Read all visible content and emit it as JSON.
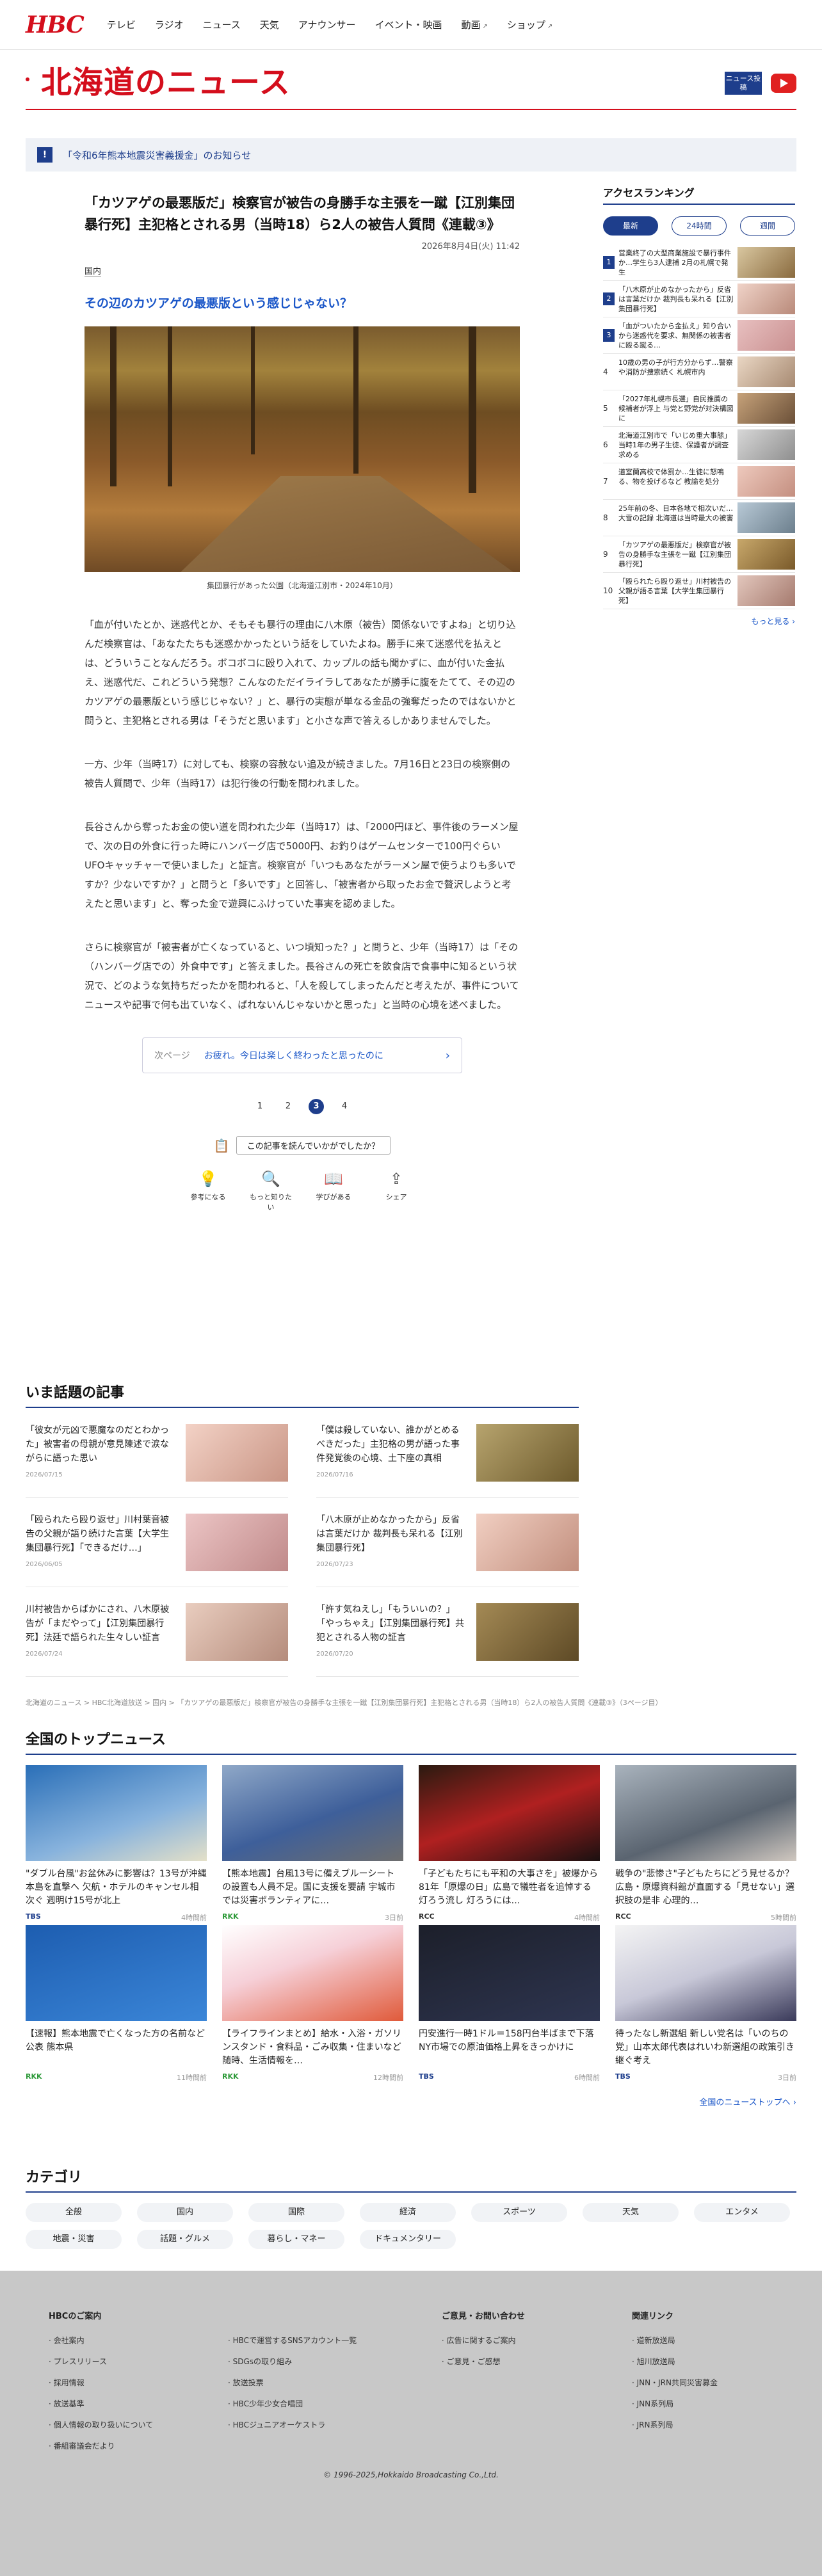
{
  "header": {
    "logo": "HBC",
    "nav": [
      {
        "label": "テレビ"
      },
      {
        "label": "ラジオ"
      },
      {
        "label": "ニュース"
      },
      {
        "label": "天気"
      },
      {
        "label": "アナウンサー"
      },
      {
        "label": "イベント・映画"
      },
      {
        "label": "動画",
        "ext": "↗"
      },
      {
        "label": "ショップ",
        "ext": "↗"
      }
    ],
    "section_title": "北海道のニュース",
    "news_badge": "ニュース投稿"
  },
  "notice": {
    "text": "「令和6年熊本地震災害義援金」のお知らせ"
  },
  "article": {
    "title": "「カツアゲの最悪版だ」検察官が被告の身勝手な主張を一蹴【江別集団暴行死】主犯格とされる男（当時18）ら2人の被告人質問《連載③》",
    "date": "2026年8月4日(火) 11:42",
    "category": "国内",
    "lead": "その辺のカツアゲの最悪版という感じじゃない？",
    "caption": "集団暴行があった公園（北海道江別市・2024年10月）",
    "paragraphs": [
      "「血が付いたとか、迷惑代とか、そもそも暴行の理由に八木原（被告）関係ないですよね」と切り込んだ検察官は、「あなたたちも迷惑かかったという話をしていたよね。勝手に来て迷惑代を払えとは、どういうことなんだろう。ボコボコに殴り入れて、カップルの話も聞かずに、血が付いた金払え、迷惑代だ、これどういう発想？こんなのただイライラしてあなたが勝手に腹をたてて、その辺のカツアゲの最悪版という感じじゃない？」と、暴行の実態が単なる金品の強奪だったのではないかと問うと、主犯格とされる男は「そうだと思います」と小さな声で答えるしかありませんでした。",
      "一方、少年（当時17）に対しても、検察の容赦ない追及が続きました。7月16日と23日の検察側の被告人質問で、少年（当時17）は犯行後の行動を問われました。",
      "長谷さんから奪ったお金の使い道を問われた少年（当時17）は、「2000円ほど、事件後のラーメン屋で、次の日の外食に行った時にハンバーグ店で5000円、お釣りはゲームセンターで100円ぐらいUFOキャッチャーで使いました」と証言。検察官が「いつもあなたがラーメン屋で使うよりも多いですか？少ないですか？」と問うと「多いです」と回答し、「被害者から取ったお金で贅沢しようと考えたと思います」と、奪った金で遊興にふけっていた事実を認めました。",
      "さらに検察官が「被害者が亡くなっていると、いつ頃知った？」と問うと、少年（当時17）は「その（ハンバーグ店での）外食中です」と答えました。長谷さんの死亡を飲食店で食事中に知るという状況で、どのような気持ちだったかを問われると、「人を殺してしまったんだと考えたが、事件についてニュースや記事で何も出ていなく、ばれないんじゃないかと思った」と当時の心境を述べました。"
    ],
    "next": {
      "label": "次ページ",
      "title": "お疲れ。今日は楽しく終わったと思ったのに"
    },
    "pages": [
      "1",
      "2",
      "3",
      "4"
    ],
    "current_page": "3",
    "feedback_q": "この記事を読んでいかがでしたか？",
    "reactions": [
      {
        "icon": "bulb-icon",
        "glyph": "💡",
        "label": "参考になる"
      },
      {
        "icon": "search-icon",
        "glyph": "🔍",
        "label": "もっと知りたい"
      },
      {
        "icon": "book-icon",
        "glyph": "📖",
        "label": "学びがある"
      },
      {
        "icon": "share-icon",
        "glyph": "⇪",
        "label": "シェア"
      }
    ]
  },
  "ranking": {
    "title": "アクセスランキング",
    "tabs": [
      "最新",
      "24時間",
      "週間"
    ],
    "items": [
      "営業終了の大型商業施設で暴行事件か…学生ら3人逮捕 2月の札幌で発生",
      "「八木原が止めなかったから」反省は言葉だけか 裁判長も呆れる【江別集団暴行死】",
      "「血がついたから金払え」知り合いから迷惑代を要求、無関係の被害者に殴る蹴る…",
      "10歳の男の子が行方分からず…警察や消防が捜索続く 札幌市内",
      "「2027年札幌市長選」自民推薦の候補者が浮上 与党と野党が対決構図に",
      "北海道江別市で「いじめ重大事態」 当時1年の男子生徒、保護者が調査求める",
      "道室蘭高校で体罰か…生徒に怒鳴る、物を投げるなど 教諭を処分",
      "25年前の冬、日本各地で相次いだ…大雪の記録 北海道は当時最大の被害",
      "「カツアゲの最悪版だ」検察官が被告の身勝手な主張を一蹴【江別集団暴行死】",
      "「殴られたら殴り返せ」川村被告の父親が語る言葉【大学生集団暴行死】"
    ],
    "more": "もっと見る ›"
  },
  "trending": {
    "title": "いま話題の記事",
    "items": [
      {
        "title": "「彼女が元凶で悪魔なのだとわかった」被害者の母親が意見陳述で涙ながらに語った思い",
        "date": "2026/07/15"
      },
      {
        "title": "「僕は殺していない、誰かがとめるべきだった」主犯格の男が語った事件発覚後の心境、土下座の真相",
        "date": "2026/07/16"
      },
      {
        "title": "「殴られたら殴り返せ」川村葉音被告の父親が語り続けた言葉【大学生集団暴行死】「できるだけ…」",
        "date": "2026/06/05"
      },
      {
        "title": "「八木原が止めなかったから」反省は言葉だけか 裁判長も呆れる【江別集団暴行死】",
        "date": "2026/07/23"
      },
      {
        "title": "川村被告からばかにされ、八木原被告が「まだやって」【江別集団暴行死】法廷で語られた生々しい証言",
        "date": "2026/07/24"
      },
      {
        "title": "「許す気ねえし」「もういいの？」「やっちゃえ」【江別集団暴行死】共犯とされる人物の証言",
        "date": "2026/07/20"
      }
    ]
  },
  "breadcrumb": "北海道のニュース > HBC北海道放送 > 国内 > 「カツアゲの最悪版だ」検察官が被告の身勝手な主張を一蹴【江別集団暴行死】主犯格とされる男（当時18）ら2人の被告人質問《連載③》（3ページ目）",
  "national": {
    "title": "全国のトップニュース",
    "items": [
      {
        "title": "\"ダブル台風\"お盆休みに影響は？13号が沖縄本島を直撃へ 欠航・ホテルのキャンセル相次ぐ 週明け15号が北上",
        "src": "TBS",
        "ago": "4時間前"
      },
      {
        "title": "【熊本地震】台風13号に備えブルーシートの設置も人員不足。国に支援を要請 宇城市では災害ボランティアに…",
        "src": "RKK",
        "ago": "3日前"
      },
      {
        "title": "「子どもたちにも平和の大事さを」被爆から81年「原爆の日」広島で犠牲者を追悼する灯ろう流し 灯ろうには…",
        "src": "RCC",
        "ago": "4時間前"
      },
      {
        "title": "戦争の\"悲惨さ\"子どもたちにどう見せるか？広島・原爆資料館が直面する「見せない」選択肢の是非 心理的…",
        "src": "RCC",
        "ago": "5時間前"
      },
      {
        "title": "【速報】熊本地震で亡くなった方の名前など公表 熊本県",
        "src": "RKK",
        "ago": "11時間前"
      },
      {
        "title": "【ライフラインまとめ】給水・入浴・ガソリンスタンド・食料品・ごみ収集・住まいなど 随時、生活情報を…",
        "src": "RKK",
        "ago": "12時間前"
      },
      {
        "title": "円安進行一時1ドル＝158円台半ばまで下落 NY市場での原油価格上昇をきっかけに",
        "src": "TBS",
        "ago": "6時間前"
      },
      {
        "title": "待ったなし新選組 新しい党名は「いのちの党」山本太郎代表はれいわ新選組の政策引き継ぐ考え",
        "src": "TBS",
        "ago": "3日前"
      }
    ],
    "all": "全国のニューストップへ ›"
  },
  "categories": {
    "title": "カテゴリ",
    "items": [
      "全般",
      "国内",
      "国際",
      "経済",
      "スポーツ",
      "天気",
      "エンタメ",
      "地震・災害",
      "話題・グルメ",
      "暮らし・マネー",
      "ドキュメンタリー"
    ]
  },
  "footer": {
    "col1": {
      "title": "HBCのご案内",
      "left": [
        "会社案内",
        "プレスリリース",
        "採用情報",
        "放送基準",
        "個人情報の取り扱いについて",
        "番組審議会だより"
      ],
      "right": [
        "HBCで運営するSNSアカウント一覧",
        "SDGsの取り組み",
        "放送投票",
        "HBC少年少女合唱団",
        "HBCジュニアオーケストラ"
      ]
    },
    "col2": {
      "title": "ご意見・お問い合わせ",
      "items": [
        "広告に関するご案内",
        "ご意見・ご感想"
      ]
    },
    "col3": {
      "title": "関連リンク",
      "items": [
        "道新放送局",
        "旭川放送局",
        "JNN・JRN共同災害募金",
        "JNN系列局",
        "JRN系列局"
      ]
    },
    "copyright": "© 1996-2025,Hokkaido Broadcasting Co.,Ltd."
  },
  "colors": {
    "brand_red": "#d40e1c",
    "navy": "#1e3e8c",
    "link_blue": "#1a56c8"
  }
}
